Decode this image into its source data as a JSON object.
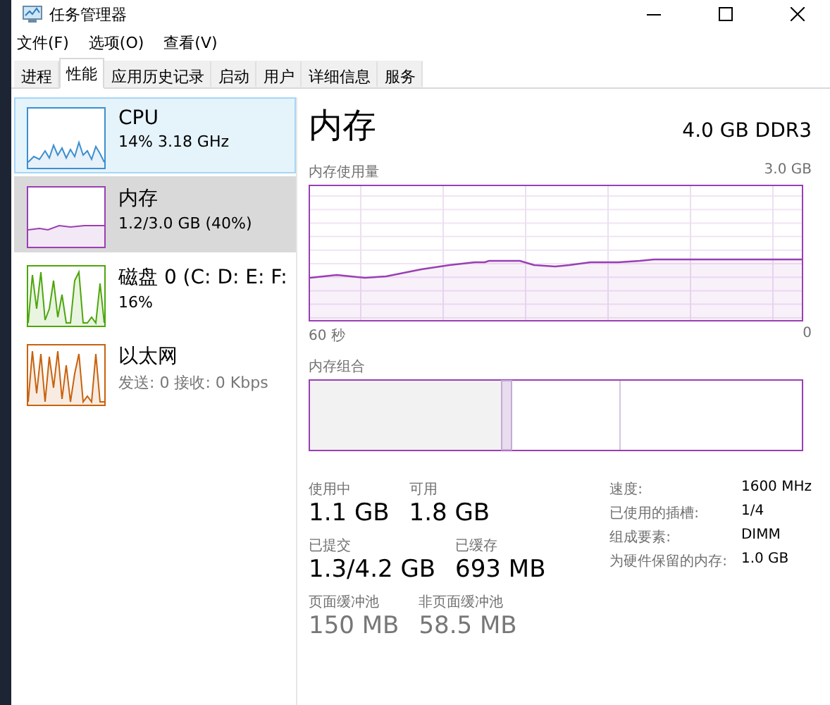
{
  "window": {
    "title": "任务管理器"
  },
  "menu": [
    "文件(F)",
    "选项(O)",
    "查看(V)"
  ],
  "tabs": [
    {
      "label": "进程",
      "selected": false
    },
    {
      "label": "性能",
      "selected": true
    },
    {
      "label": "应用历史记录",
      "selected": false
    },
    {
      "label": "启动",
      "selected": false
    },
    {
      "label": "用户",
      "selected": false
    },
    {
      "label": "详细信息",
      "selected": false
    },
    {
      "label": "服务",
      "selected": false
    }
  ],
  "sidebar": {
    "items": [
      {
        "kind": "cpu",
        "name": "CPU",
        "detail": "14% 3.18 GHz",
        "color": "#3c8fcf",
        "selected": false,
        "hovered": true
      },
      {
        "kind": "memory",
        "name": "内存",
        "detail": "1.2/3.0 GB (40%)",
        "color": "#9a3fb3",
        "selected": true,
        "hovered": false
      },
      {
        "kind": "disk",
        "name": "磁盘 0 (C: D: E: F:",
        "detail": "16%",
        "color": "#4da60c",
        "selected": false,
        "hovered": false
      },
      {
        "kind": "network",
        "name": "以太网",
        "detail": "发送: 0 接收: 0 Kbps",
        "color": "#c8620e",
        "selected": false,
        "hovered": false
      }
    ]
  },
  "detail": {
    "title": "内存",
    "capacity": "4.0 GB DDR3",
    "usage_label": "内存使用量",
    "usage_max": "3.0 GB",
    "time_start": "60 秒",
    "time_end": "0",
    "composition_label": "内存组合",
    "stat_rows": [
      [
        {
          "label": "使用中",
          "value": "1.1 GB",
          "muted": false
        },
        {
          "label": "可用",
          "value": "1.8 GB",
          "muted": false
        }
      ],
      [
        {
          "label": "已提交",
          "value": "1.3/4.2 GB",
          "muted": false
        },
        {
          "label": "已缓存",
          "value": "693 MB",
          "muted": false
        }
      ],
      [
        {
          "label": "页面缓冲池",
          "value": "150 MB",
          "muted": true
        },
        {
          "label": "非页面缓冲池",
          "value": "58.5 MB",
          "muted": true
        }
      ]
    ],
    "specs": [
      {
        "label": "速度:",
        "value": "1600 MHz"
      },
      {
        "label": "已使用的插槽:",
        "value": "1/4"
      },
      {
        "label": "组成要素:",
        "value": "DIMM"
      },
      {
        "label": "为硬件保留的内存:",
        "value": "1.0 GB"
      }
    ]
  }
}
